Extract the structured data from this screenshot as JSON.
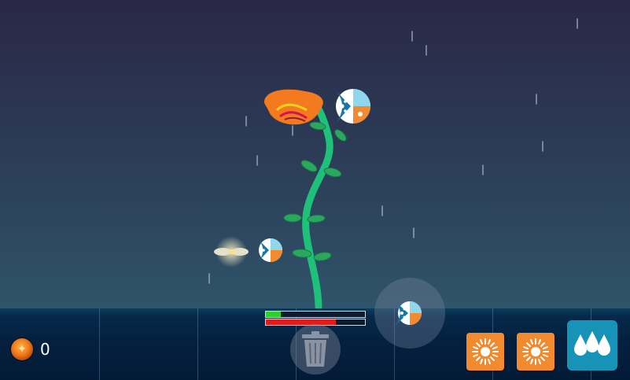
{
  "hud": {
    "coins": {
      "icon": "coin-icon",
      "value": "0"
    },
    "growth": {
      "water_level": 0.15,
      "health_level": 0.71,
      "water_color": "#2bd02b",
      "health_color": "#e21b1b"
    }
  },
  "tools": [
    {
      "name": "sun-tool-button",
      "icon": "sun-icon",
      "color": "#f28a30"
    },
    {
      "name": "sun-tool-button-2",
      "icon": "sun-icon",
      "color": "#f28a30"
    },
    {
      "name": "water-tool-button",
      "icon": "water-drops-icon",
      "color": "#1893b8"
    }
  ],
  "trash": {
    "icon": "trash-icon"
  },
  "colors": {
    "sky_top": "#2a2a4a",
    "sky_bottom": "#2c5068",
    "stem": "#1ec07a",
    "flower": "#f47a20",
    "ground": "#04203f"
  }
}
